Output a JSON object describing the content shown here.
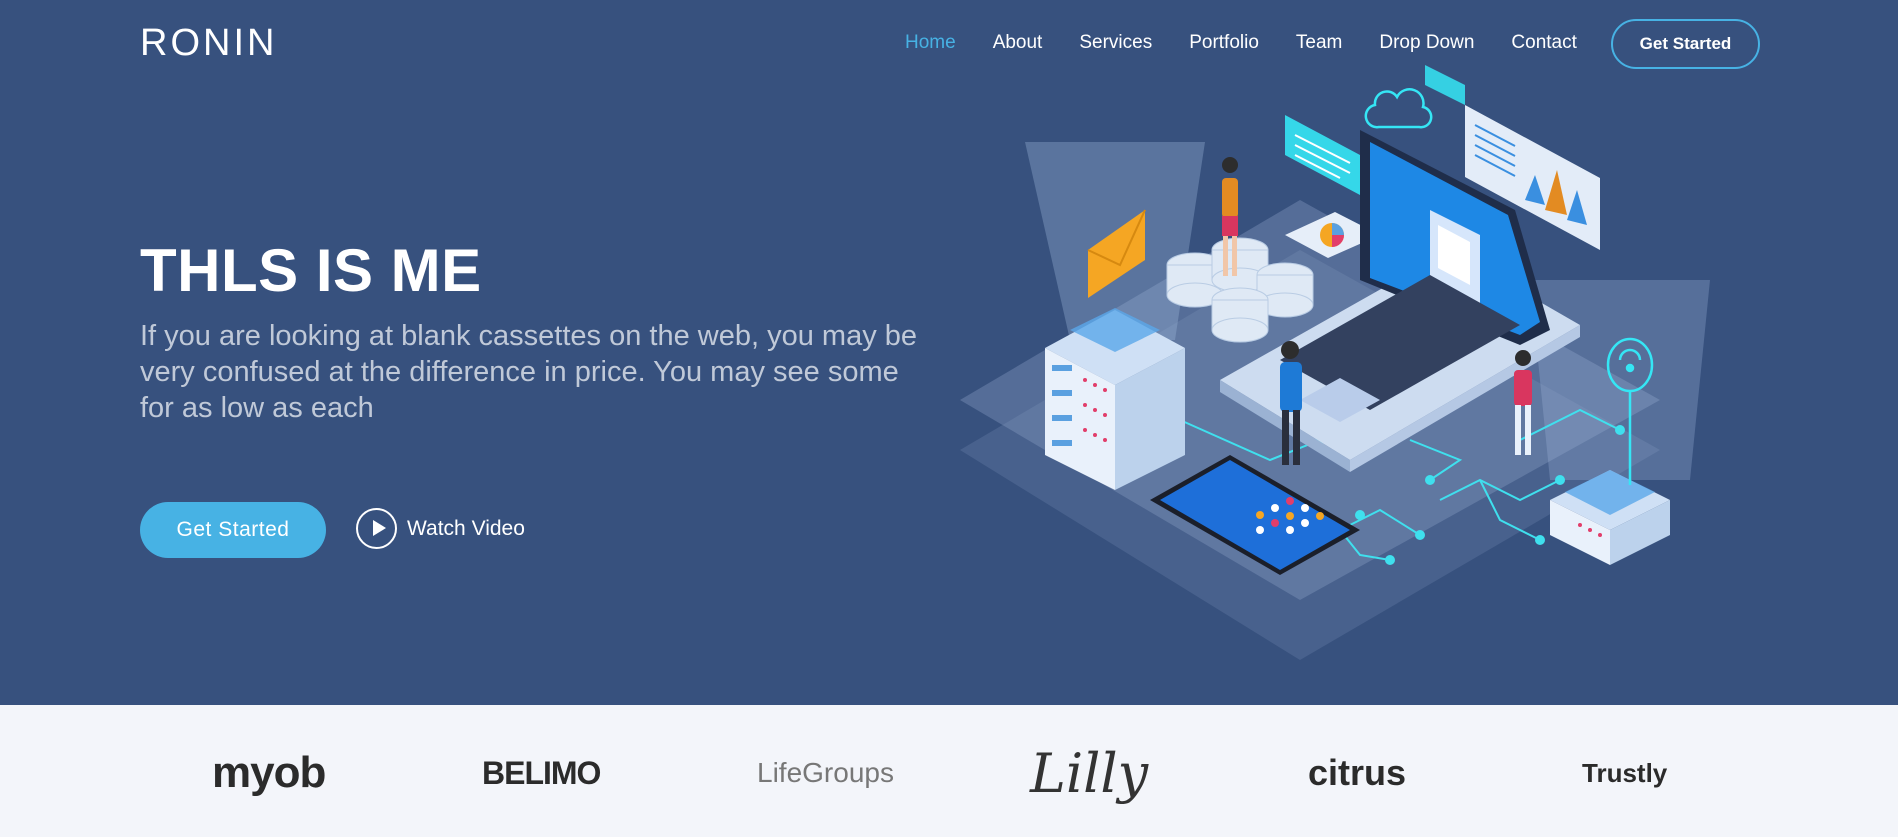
{
  "header": {
    "logo": "RONIN",
    "nav": [
      {
        "label": "Home",
        "active": true
      },
      {
        "label": "About",
        "active": false
      },
      {
        "label": "Services",
        "active": false
      },
      {
        "label": "Portfolio",
        "active": false
      },
      {
        "label": "Team",
        "active": false
      },
      {
        "label": "Drop Down",
        "active": false
      },
      {
        "label": "Contact",
        "active": false
      }
    ],
    "cta_label": "Get Started"
  },
  "hero": {
    "title": "THLS IS ME",
    "subtitle": "If you are looking at blank cassettes on the web, you may be very confused at the difference in price. You may see some for as low as each",
    "primary_button": "Get Started",
    "video_button": "Watch Video"
  },
  "clients": [
    "myob",
    "BELIMO",
    "LifeGroups",
    "Lilly",
    "citrus",
    "Trustly"
  ],
  "colors": {
    "hero_bg": "#37517e",
    "accent": "#47b2e4",
    "clients_bg": "#f3f5fa"
  },
  "icons": [
    "play-icon",
    "envelope-icon",
    "cloud-icon",
    "wifi-icon",
    "chart-icon"
  ]
}
